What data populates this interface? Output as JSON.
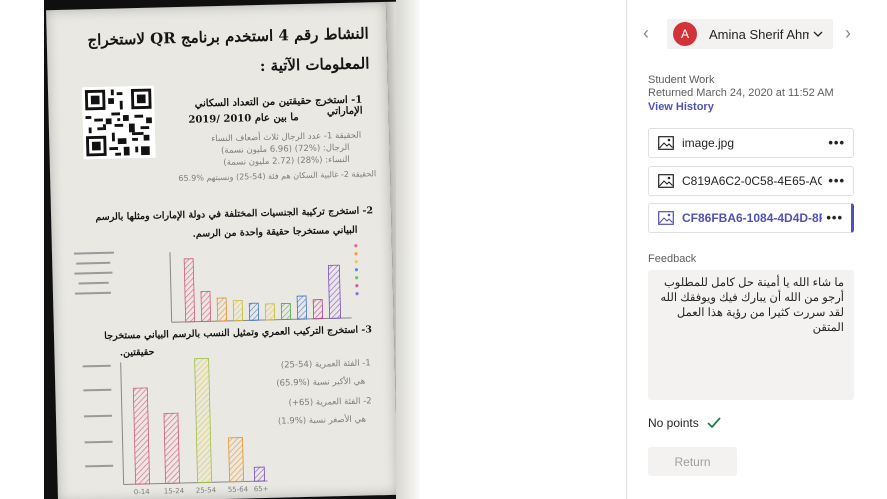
{
  "viewer": {
    "worksheet": {
      "title_line1": "النشاط رقم 4 استخدم برنامج QR لاستخراج",
      "title_line2": "المعلومات الآتية :",
      "q1": "1- استخرج حقيقتين من التعداد السكاني الإماراتي",
      "q1_years": "ما بين عام 2010 /2019",
      "q2": "2- استخرج تركيبة الجنسيات المختلفة في دولة الإمارات ومثلها بالرسم",
      "q2_line2": "البياني مستخرجا حقيقة واحدة من الرسم.",
      "q3": "3- استخرج التركيب العمري وتمثيل النسب بالرسم البياني مستخرجا",
      "q3_line2": "حقيقتين.",
      "hw1": "الحقيقة 1- عدد الرجال ثلاث أضعاف النساء",
      "hw1b": "الرجال: (%72) (6.96 مليون نسمة)",
      "hw1c": "النساء: (%28) (2.72 مليون نسمة)",
      "hw2": "الحقيقة 2- غالبية السكان هم فئة (54-25) ونسبتهم %65.9",
      "hw3": "1- الفئة العمرية (54-25)",
      "hw3b": "هي الأكبر نسبة (%65.9)",
      "hw4": "2- الفئة العمرية (65+)",
      "hw4b": "هي الأصغر نسبة (%1.9)",
      "x_labels": [
        "0-14",
        "15-24",
        "25-54",
        "55-64",
        "65+"
      ]
    }
  },
  "panel": {
    "student": {
      "initial": "A",
      "name": "Amina Sherif Ahm..."
    },
    "student_work_label": "Student Work",
    "returned_text": "Returned March 24, 2020 at 11:52 AM",
    "view_history": "View History",
    "files": [
      {
        "name": "image.jpg"
      },
      {
        "name": "C819A6C2-0C58-4E65-ACF…"
      },
      {
        "name": "CF86FBA6-1084-4D4D-8FC"
      }
    ],
    "more_glyph": "•••",
    "feedback_label": "Feedback",
    "feedback_text": "ما شاء الله يا أمينة حل كامل للمطلوب أرجو من الله أن يبارك فيك ويوفقك الله لقد سررت كثيرا من رؤية هذا العمل المتقن",
    "points_text": "No points",
    "return_button": "Return",
    "colors": {
      "accent": "#4f52b2",
      "avatar": "#d13438",
      "check": "#237b4b"
    }
  }
}
